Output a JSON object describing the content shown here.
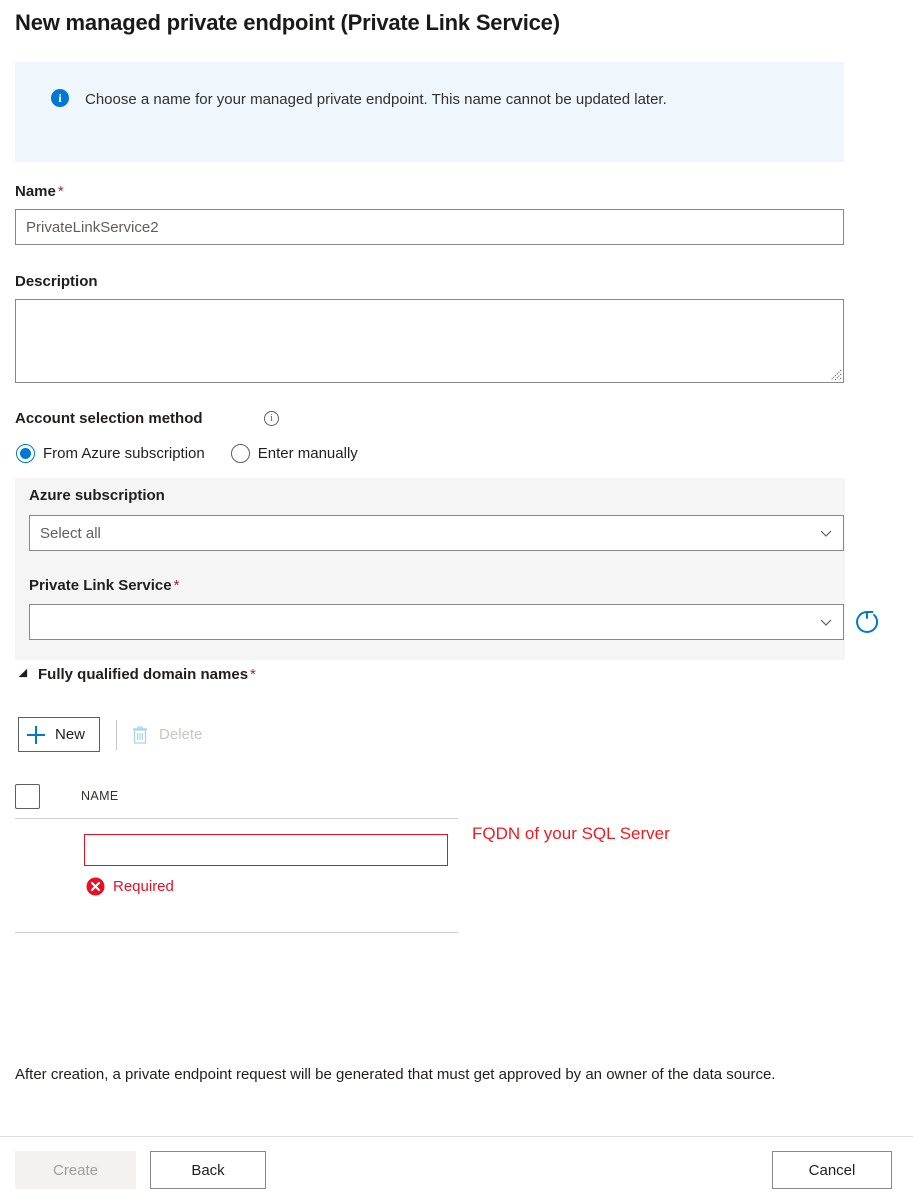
{
  "page_title": "New managed private endpoint (Private Link Service)",
  "info_banner": {
    "icon": "info-circle-icon",
    "text": "Choose a name for your managed private endpoint. This name cannot be updated later."
  },
  "name_field": {
    "label": "Name",
    "required_marker": "*",
    "value": "",
    "placeholder": "PrivateLinkService2"
  },
  "description_field": {
    "label": "Description",
    "value": "",
    "placeholder": ""
  },
  "account_selection": {
    "label": "Account selection method",
    "info_icon": "info-outline-icon",
    "options": [
      {
        "label": "From Azure subscription",
        "selected": true
      },
      {
        "label": "Enter manually",
        "selected": false
      }
    ]
  },
  "subscription_field": {
    "label": "Azure subscription",
    "value": "Select all",
    "chevron": "chevron-down-icon"
  },
  "private_link_service_field": {
    "label": "Private Link Service",
    "required_marker": "*",
    "value": "",
    "chevron": "chevron-down-icon",
    "refresh_icon": "refresh-icon"
  },
  "fqdn_section": {
    "title": "Fully qualified domain names",
    "required_marker": "*",
    "expand_icon": "triangle-expanded-icon",
    "toolbar": {
      "new_label": "New",
      "new_icon": "plus-icon",
      "delete_label": "Delete",
      "delete_icon": "trash-icon",
      "delete_disabled": true
    },
    "table": {
      "columns": [
        "NAME"
      ],
      "select_all_checkbox": false,
      "rows": [
        {
          "name_value": "",
          "error_icon": "error-circle-icon",
          "error_text": "Required"
        }
      ]
    },
    "annotation": "FQDN of your SQL Server"
  },
  "footer_note": "After creation, a private endpoint request will be generated that must get approved by an owner of the data source.",
  "footer_buttons": {
    "create": "Create",
    "back": "Back",
    "cancel": "Cancel",
    "create_disabled": true
  },
  "colors": {
    "accent": "#0078d4",
    "banner_bg": "#eff6fc",
    "panel_bg": "#f5f5f5",
    "required_star": "#a4262c",
    "error_red": "#e81123",
    "annotation_red": "#ed1c24",
    "disabled_text": "#a19f9d"
  }
}
